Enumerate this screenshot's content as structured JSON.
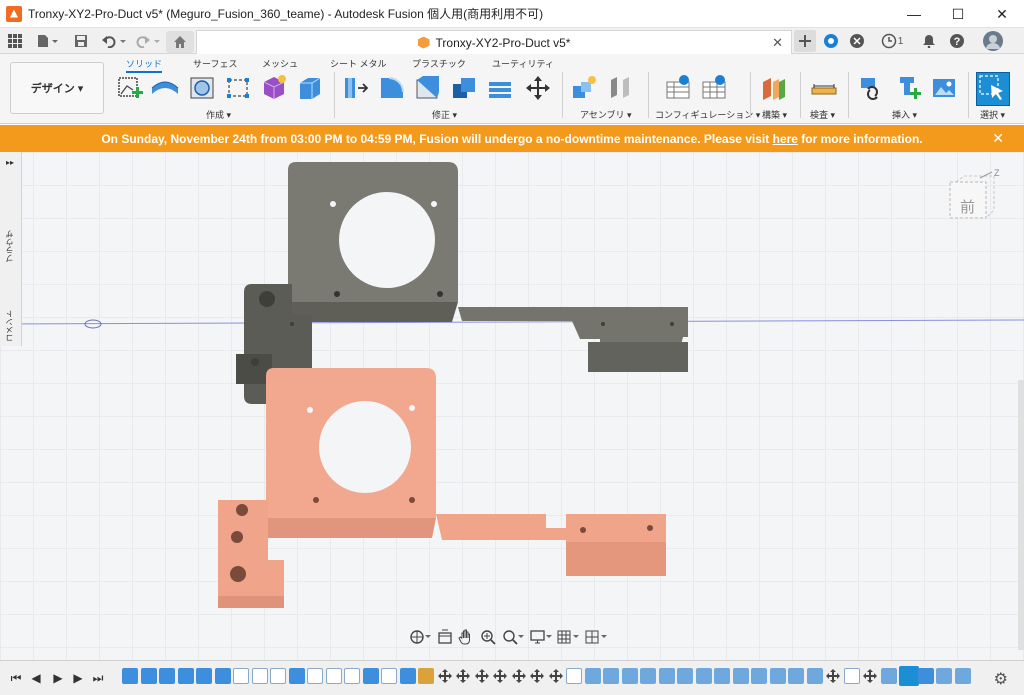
{
  "window": {
    "title": "Tronxy-XY2-Pro-Duct v5* (Meguro_Fusion_360_teame) - Autodesk Fusion 個人用(商用利用不可)",
    "minimize": "—",
    "maximize": "☐",
    "close": "✕"
  },
  "tabbar": {
    "doc_tab_title": "Tronxy-XY2-Pro-Duct v5*",
    "doc_tab_close": "✕",
    "clock_count": "1",
    "icons": [
      "grid-icon",
      "file-icon",
      "save-icon",
      "undo-icon",
      "redo-icon",
      "home-icon",
      "plus-icon",
      "extensions-icon",
      "online-icon",
      "clock-icon",
      "bell-icon",
      "help-icon",
      "user-avatar-icon"
    ]
  },
  "ribbon": {
    "workspace": "デザイン ▾",
    "tabs": [
      "ソリッド",
      "サーフェス",
      "メッシュ",
      "シート メタル",
      "プラスチック",
      "ユーティリティ"
    ],
    "active_tab": "ソリッド",
    "groups": {
      "create": "作成 ▾",
      "modify": "修正 ▾",
      "assemble": "アセンブリ ▾",
      "configure": "コンフィギュレーション ▾",
      "construct": "構築 ▾",
      "inspect": "検査 ▾",
      "insert": "挿入 ▾",
      "select": "選択 ▾"
    }
  },
  "banner": {
    "text_before": "On Sunday, November 24th from 03:00 PM to 04:59 PM, Fusion will undergo a no-downtime maintenance. Please visit ",
    "link": "here",
    "text_after": " for more information.",
    "close": "✕"
  },
  "browser_panel": {
    "expand": "▸▸",
    "browser_label": "ブラウザ",
    "comments_label": "コメント"
  },
  "viewcube": {
    "label": "前",
    "axis_z": "Z"
  },
  "timeline": {
    "play_controls": [
      "⏮",
      "◀",
      "▶",
      "▶",
      "⏭"
    ]
  },
  "colors": {
    "banner": "#f39a1d",
    "accent": "#0a74d4",
    "part_gray": "#7b7b73",
    "part_salmon": "#f0a58a"
  }
}
